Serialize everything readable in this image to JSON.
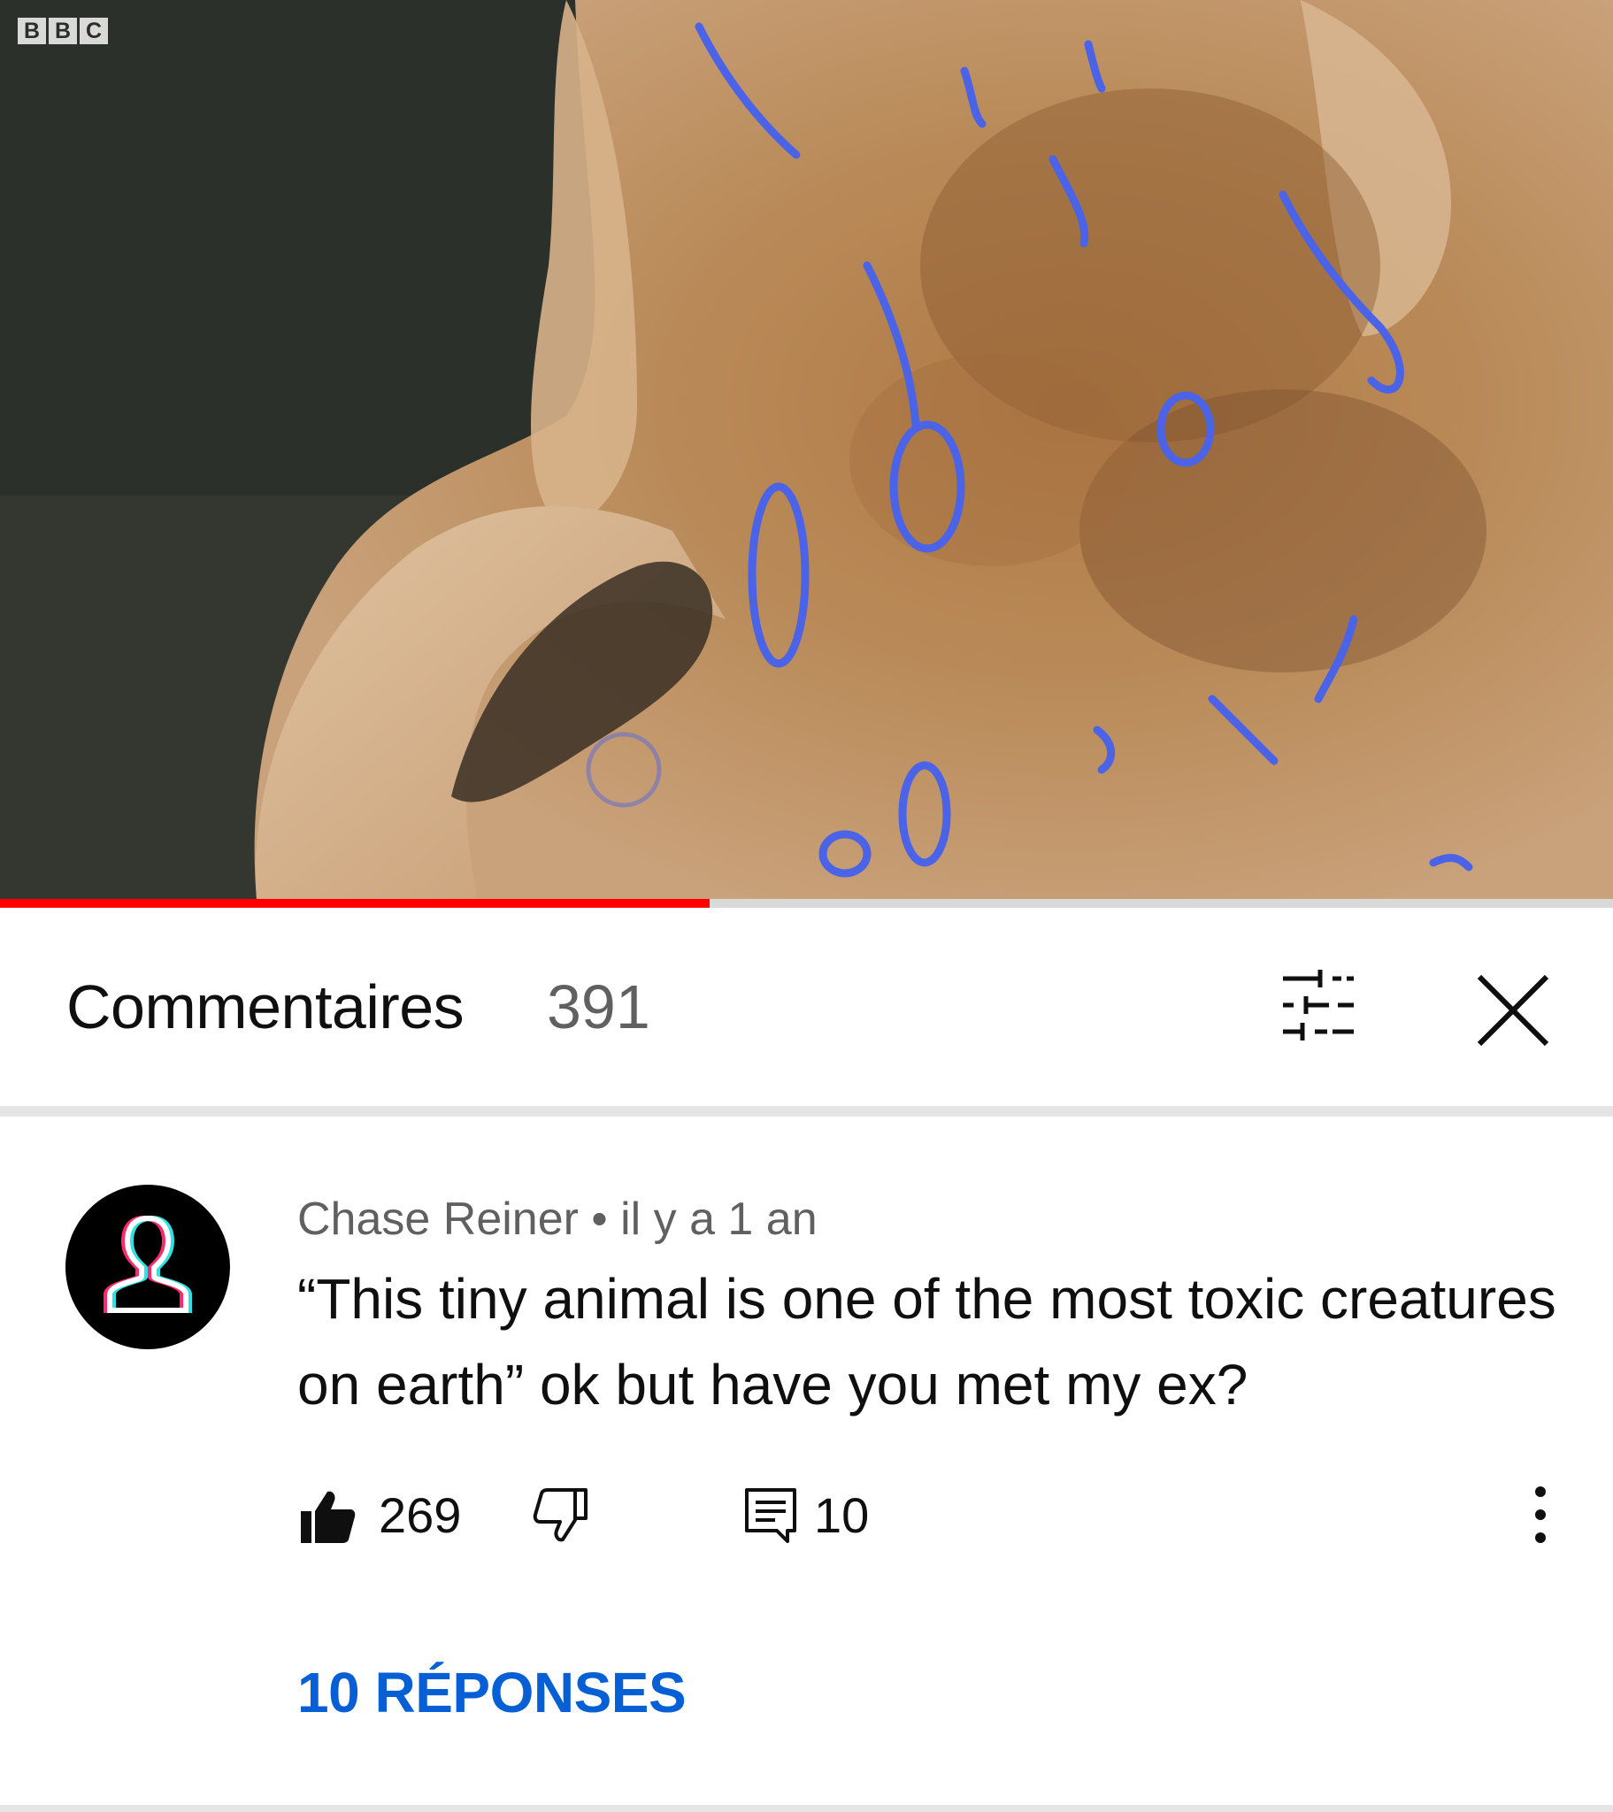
{
  "video": {
    "channel_logo": [
      "B",
      "B",
      "C"
    ],
    "progress_fraction": 0.44
  },
  "comments_header": {
    "title": "Commentaires",
    "count": "391",
    "sort_icon": "sliders-icon",
    "close_icon": "close-icon"
  },
  "comment": {
    "author": "Chase Reiner",
    "separator": " • ",
    "time": "il y a 1 an",
    "text": "“This tiny animal is one of the most toxic creatures on earth” ok but have you met my ex?",
    "likes": "269",
    "replies_count": "10",
    "replies_link": "10 RÉPONSES",
    "like_icon": "thumbs-up-icon",
    "dislike_icon": "thumbs-down-icon",
    "reply_icon": "reply-icon",
    "more_icon": "more-vert-icon"
  },
  "colors": {
    "progress": "#ff0000",
    "link": "#065fd4",
    "primary_text": "#0f0f0f",
    "secondary_text": "#606060"
  }
}
